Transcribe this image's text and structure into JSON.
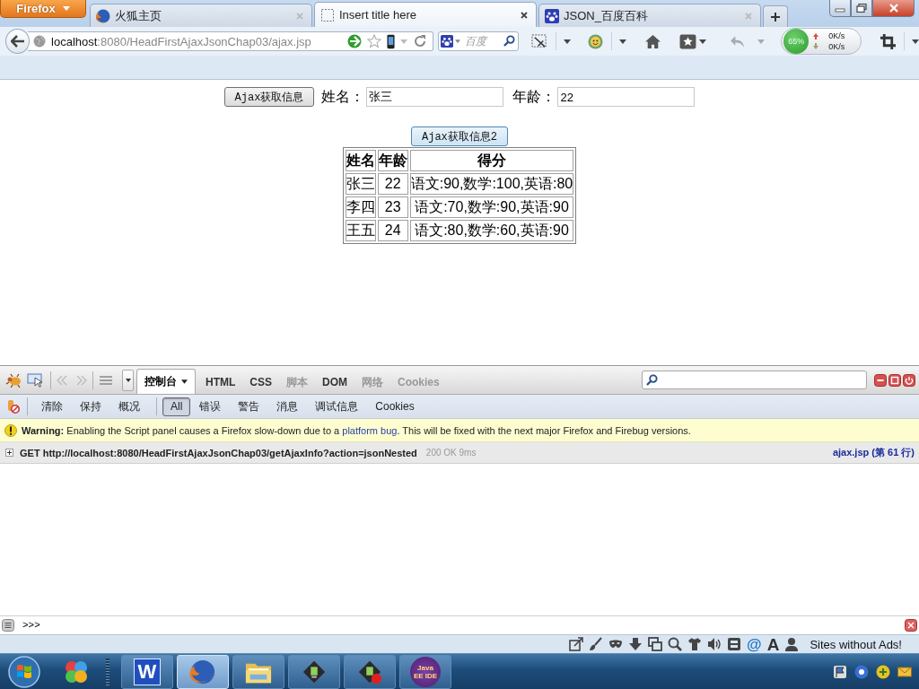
{
  "browser": {
    "menu_button": "Firefox",
    "tabs": [
      {
        "title": "火狐主页",
        "selected": false
      },
      {
        "title": "Insert title here",
        "selected": true
      },
      {
        "title": "JSON_百度百科",
        "selected": false
      }
    ],
    "address_bar": {
      "host": "localhost",
      "path": ":8080/HeadFirstAjaxJsonChap03/ajax.jsp"
    },
    "search_bar": {
      "placeholder": "百度"
    },
    "network_monitor": {
      "percent": "65%",
      "upload": "0K/s",
      "download": "0K/s"
    }
  },
  "page": {
    "fetch_button": "Ajax获取信息",
    "fields": [
      {
        "label": "姓名：",
        "value": "张三"
      },
      {
        "label": "年龄：",
        "value": "22"
      }
    ],
    "fetch_button_2": "Ajax获取信息2",
    "table": {
      "columns": [
        "姓名",
        "年龄",
        "得分"
      ],
      "rows": [
        [
          "张三",
          "22",
          "语文:90,数学:100,英语:80"
        ],
        [
          "李四",
          "23",
          "语文:70,数学:90,英语:90"
        ],
        [
          "王五",
          "24",
          "语文:80,数学:60,英语:90"
        ]
      ]
    }
  },
  "firebug": {
    "panels": [
      {
        "label": "控制台",
        "selected": true,
        "disabled": false
      },
      {
        "label": "HTML",
        "selected": false,
        "disabled": false
      },
      {
        "label": "CSS",
        "selected": false,
        "disabled": false
      },
      {
        "label": "脚本",
        "selected": false,
        "disabled": true
      },
      {
        "label": "DOM",
        "selected": false,
        "disabled": false
      },
      {
        "label": "网络",
        "selected": false,
        "disabled": true
      },
      {
        "label": "Cookies",
        "selected": false,
        "disabled": true
      }
    ],
    "console_actions": [
      "清除",
      "保持",
      "概况"
    ],
    "filters": [
      {
        "label": "All",
        "selected": true
      },
      {
        "label": "错误",
        "selected": false
      },
      {
        "label": "警告",
        "selected": false
      },
      {
        "label": "消息",
        "selected": false
      },
      {
        "label": "调试信息",
        "selected": false
      },
      {
        "label": "Cookies",
        "selected": false
      }
    ],
    "warning": {
      "text": "**Warning:** Enabling the Script panel causes a Firefox slow-down due to a",
      "link": "platform bug",
      "text_after": ". This will be fixed with the next major Firefox and Firebug versions."
    },
    "requests": [
      {
        "expanded": false,
        "request": "GET http://localhost:8080/HeadFirstAjaxJsonChap03/getAjaxInfo?action=jsonNested",
        "status": "200 OK",
        "time": "9ms",
        "source": "ajax.jsp (第 61 行)"
      }
    ],
    "command_prompt": ">>>"
  },
  "addon_bar": {
    "glyphs": [
      "@",
      "A"
    ],
    "label": "Sites without Ads!"
  },
  "taskbar": {
    "items": [
      {
        "label": "W",
        "selected": false
      },
      {
        "selected": true
      },
      {
        "selected": false
      },
      {
        "selected": false
      },
      {
        "selected": false
      },
      {
        "label": "Java EE IDE",
        "selected": false
      }
    ]
  }
}
